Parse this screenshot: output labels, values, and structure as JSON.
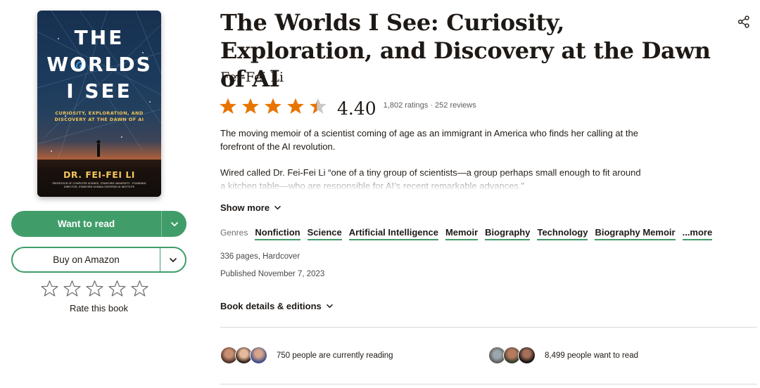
{
  "book": {
    "title": "The Worlds I See: Curiosity, Exploration, and Discovery at the Dawn of AI",
    "author": "Fei-Fei Li",
    "rating": {
      "stars_filled": 4.4,
      "average": "4.40",
      "counts": "1,802 ratings · 252 reviews"
    },
    "description": {
      "paragraph1": "The moving memoir of a scientist coming of age as an immigrant in America who finds her calling at the forefront of the AI revolution.",
      "paragraph2": "Wired called Dr. Fei-Fei Li “one of a tiny group of scientists—a group perhaps small enough to fit around a kitchen table—who are responsible for AI’s recent remarkable advances.”",
      "show_more": "Show more"
    },
    "genres_label": "Genres",
    "genres": [
      "Nonfiction",
      "Science",
      "Artificial Intelligence",
      "Memoir",
      "Biography",
      "Technology",
      "Biography Memoir",
      "...more"
    ],
    "pages_format": "336 pages, Hardcover",
    "published": "Published November 7, 2023",
    "details_link": "Book details & editions"
  },
  "cover": {
    "title_line1": "THE",
    "title_line2": "WORLDS",
    "title_line3": "I SEE",
    "subtitle": "CURIOSITY, EXPLORATION, AND DISCOVERY AT THE DAWN OF AI",
    "author": "DR. FEI-FEI LI",
    "credentials": "PROFESSOR OF COMPUTER SCIENCE, STANFORD UNIVERSITY · FOUNDING DIRECTOR, STANFORD HUMAN-CENTERED AI INSTITUTE"
  },
  "actions": {
    "want_to_read": "Want to read",
    "buy": "Buy on Amazon",
    "rate_label": "Rate this book"
  },
  "social": {
    "currently_reading": "750 people are currently reading",
    "want_to_read": "8,499 people want to read"
  },
  "colors": {
    "accent_green": "#409d69",
    "star_orange": "#e87400",
    "star_empty": "#c9c9c9"
  },
  "icons": [
    "share-icon",
    "chevron-down-icon",
    "star-icon",
    "star-outline-icon"
  ]
}
